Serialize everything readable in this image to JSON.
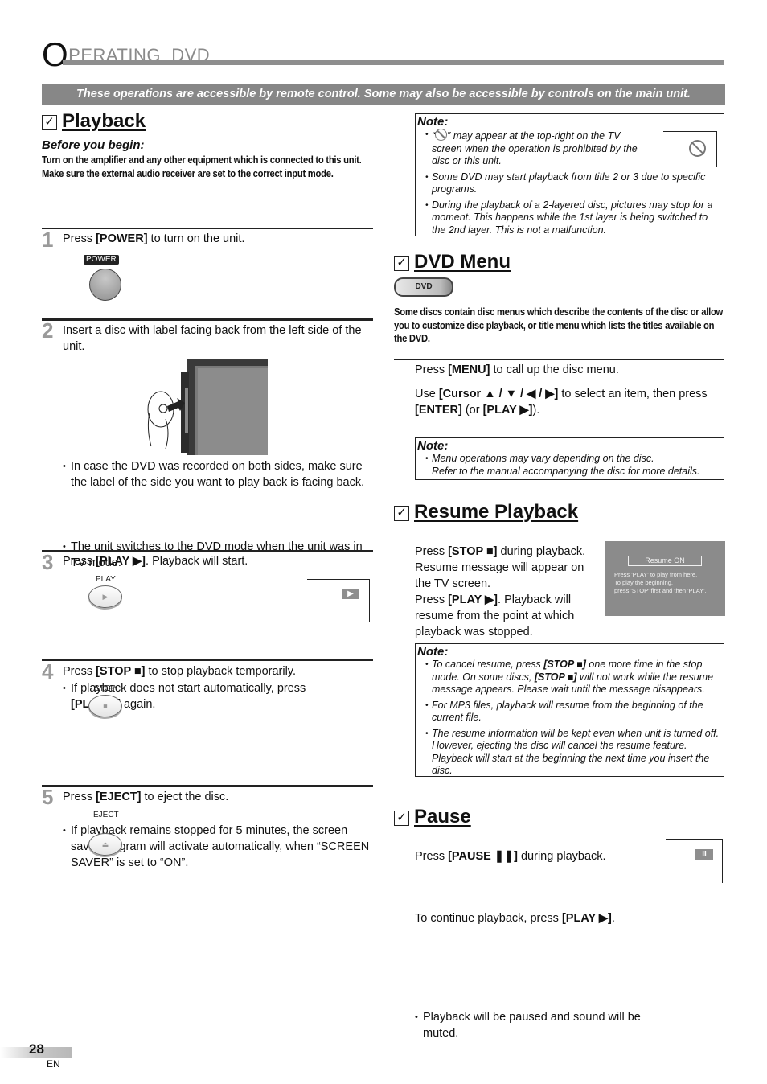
{
  "page": {
    "title_initial": "O",
    "title_rest": "PERATING  DVD",
    "banner": "These operations are accessible by remote control.  Some may also be accessible by controls on the main unit.",
    "page_number": "28",
    "language": "EN"
  },
  "playback": {
    "heading": "Playback",
    "before_title": "Before you begin:",
    "before_text": "Turn on the amplifier and any other equipment which is connected to this unit. Make sure the external audio receiver are set to the correct input mode.",
    "steps": [
      {
        "num": "1",
        "pre": "Press ",
        "key": "[POWER]",
        "post": " to turn on the unit.",
        "button_label": "POWER",
        "button_icon": "power-button"
      },
      {
        "num": "2",
        "text": "Insert a disc with label facing back from the left side of the unit.",
        "illustration": "disc-insertion-illustration",
        "bullets": [
          "In case the DVD was recorded on both sides, make sure the label of the side you want to play back is facing back.",
          "The unit switches to the DVD mode when the unit was in TV mode."
        ]
      },
      {
        "num": "3",
        "pre": "Press ",
        "key": "[PLAY ▶]",
        "post": ". Playback will start.",
        "button_label": "PLAY",
        "button_glyph": "▶",
        "osd_glyph": "▶",
        "bullet_pre": "If playback does not start automatically, press ",
        "bullet_key": "[PLAY ▶]",
        "bullet_post": " again."
      },
      {
        "num": "4",
        "pre": "Press ",
        "key": "[STOP ■]",
        "post": " to stop playback temporarily.",
        "button_label": "STOP",
        "button_glyph": "■",
        "bullet": "If playback remains stopped for 5 minutes, the screen saver program will activate automatically, when “SCREEN SAVER” is set to “ON”."
      },
      {
        "num": "5",
        "pre": "Press ",
        "key": "[EJECT]",
        "post": " to eject the disc.",
        "button_label": "EJECT",
        "button_glyph": "⏏"
      }
    ]
  },
  "note_top": {
    "title": "Note:",
    "items": [
      "“⃠” may appear at the top-right on the TV screen when the operation is prohibited by the disc or this unit.",
      "Some DVD may start playback from title 2 or 3 due to specific programs.",
      "During the playback of a 2-layered disc, pictures may stop for a moment. This happens while the 1st layer is being switched to the 2nd layer. This is not a malfunction."
    ],
    "item1_pre": "“",
    "item1_post": "” may appear at the top-right on the TV screen when the operation is prohibited by the disc or this unit.",
    "prohibited_icon": "⃠"
  },
  "dvd_menu": {
    "heading": "DVD Menu",
    "mode_label": "DVD",
    "intro": "Some discs contain disc menus which describe the contents of the disc or allow you to customize disc playback, or title menu which lists the titles available on the DVD.",
    "step1_pre": "Press ",
    "step1_key": "[MENU]",
    "step1_post": " to call up the disc menu.",
    "step2_pre": "Use ",
    "step2_key": "[Cursor ▲ / ▼ / ◀ / ▶]",
    "step2_mid": " to select an item, then press ",
    "step2_key2": "[ENTER]",
    "step2_mid2": " (or ",
    "step2_key3": "[PLAY ▶]",
    "step2_post": ").",
    "note_title": "Note:",
    "note_lines": [
      "Menu operations may vary depending on the disc.",
      "Refer to the manual accompanying the disc for more details."
    ]
  },
  "resume": {
    "heading": "Resume Playback",
    "p1_pre": "Press ",
    "p1_key": "[STOP ■]",
    "p1_post": " during playback. Resume message will appear on the TV screen.",
    "p2_pre": "Press ",
    "p2_key": "[PLAY ▶]",
    "p2_post": ". Playback will resume from the point at which playback was stopped.",
    "screen": {
      "title": "Resume ON",
      "lines": [
        "Press 'PLAY' to play from here.",
        "To play the beginning,",
        "press 'STOP' first and then 'PLAY'."
      ]
    },
    "note_title": "Note:",
    "note1_pre": "To cancel resume, press ",
    "note1_key": "[STOP ■]",
    "note1_mid": " one more time in the stop mode. On some discs, ",
    "note1_key2": "[STOP ■]",
    "note1_post": " will not work while the resume message appears. Please wait until the message disappears.",
    "note2": "For MP3 files, playback will resume from the beginning of the current file.",
    "note3": "The resume information will be kept even when unit is turned off. However, ejecting the disc will cancel the resume feature. Playback will start at the beginning the next time you insert the disc."
  },
  "pause": {
    "heading": "Pause",
    "p1_pre": "Press ",
    "p1_key": "[PAUSE ❚❚]",
    "p1_post": " during playback.",
    "bullet": "Playback will be paused and sound will be muted.",
    "p2_pre": "To continue playback, press ",
    "p2_key": "[PLAY ▶]",
    "p2_post": ".",
    "osd_glyph": "II"
  }
}
